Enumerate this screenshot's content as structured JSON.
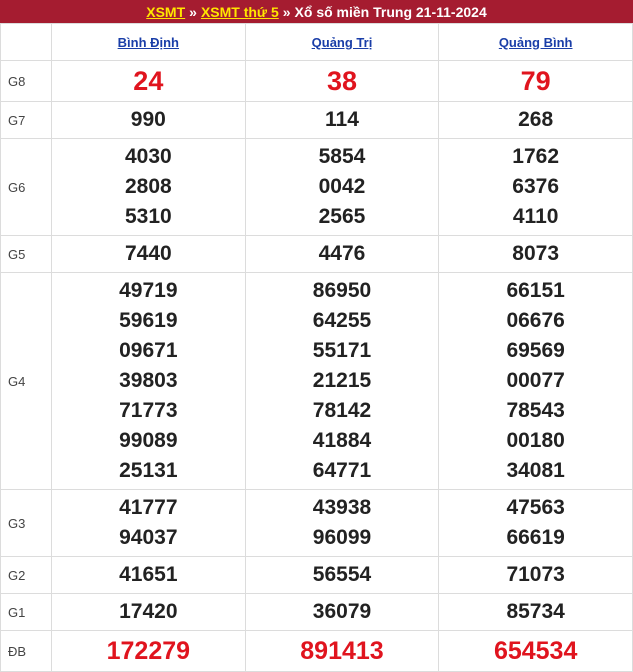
{
  "header": {
    "link1": "XSMT",
    "sep1": "»",
    "link2": "XSMT thứ 5",
    "sep2": "»",
    "title": "Xổ số miền Trung 21-11-2024"
  },
  "provinces": [
    "Bình Định",
    "Quảng Trị",
    "Quảng Bình"
  ],
  "prizes": [
    {
      "label": "G8",
      "values": [
        [
          "24"
        ],
        [
          "38"
        ],
        [
          "79"
        ]
      ]
    },
    {
      "label": "G7",
      "values": [
        [
          "990"
        ],
        [
          "114"
        ],
        [
          "268"
        ]
      ]
    },
    {
      "label": "G6",
      "values": [
        [
          "4030",
          "2808",
          "5310"
        ],
        [
          "5854",
          "0042",
          "2565"
        ],
        [
          "1762",
          "6376",
          "4110"
        ]
      ]
    },
    {
      "label": "G5",
      "values": [
        [
          "7440"
        ],
        [
          "4476"
        ],
        [
          "8073"
        ]
      ]
    },
    {
      "label": "G4",
      "values": [
        [
          "49719",
          "59619",
          "09671",
          "39803",
          "71773",
          "99089",
          "25131"
        ],
        [
          "86950",
          "64255",
          "55171",
          "21215",
          "78142",
          "41884",
          "64771"
        ],
        [
          "66151",
          "06676",
          "69569",
          "00077",
          "78543",
          "00180",
          "34081"
        ]
      ]
    },
    {
      "label": "G3",
      "values": [
        [
          "41777",
          "94037"
        ],
        [
          "43938",
          "96099"
        ],
        [
          "47563",
          "66619"
        ]
      ]
    },
    {
      "label": "G2",
      "values": [
        [
          "41651"
        ],
        [
          "56554"
        ],
        [
          "71073"
        ]
      ]
    },
    {
      "label": "G1",
      "values": [
        [
          "17420"
        ],
        [
          "36079"
        ],
        [
          "85734"
        ]
      ]
    },
    {
      "label": "ĐB",
      "values": [
        [
          "172279"
        ],
        [
          "891413"
        ],
        [
          "654534"
        ]
      ]
    }
  ],
  "colors": {
    "header_bg": "#a51c30",
    "header_link": "#ffe600",
    "highlight": "#e0141e",
    "province_link": "#1a3ea8"
  }
}
